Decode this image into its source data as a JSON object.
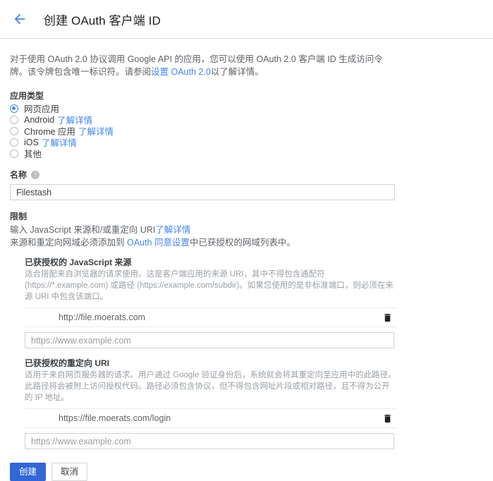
{
  "header": {
    "back_icon": "arrow-left-icon",
    "title": "创建 OAuth 客户端 ID"
  },
  "intro": {
    "text_before": "对于使用 OAuth 2.0 协议调用 Google API 的应用，您可以使用 OAuth 2.0 客户端 ID 生成访问令牌。该令牌包含唯一标识符。请参阅",
    "link": "设置 OAuth 2.0",
    "text_after": "以了解详情。"
  },
  "application_type": {
    "label": "应用类型",
    "selected": "网页应用",
    "options": [
      {
        "label": "网页应用",
        "link": "",
        "selected": true
      },
      {
        "label": "Android",
        "link": "了解详情",
        "selected": false
      },
      {
        "label": "Chrome 应用",
        "link": "了解详情",
        "selected": false
      },
      {
        "label": "iOS",
        "link": "了解详情",
        "selected": false
      },
      {
        "label": "其他",
        "link": "",
        "selected": false
      }
    ]
  },
  "name_field": {
    "label": "名称",
    "help_icon": "help-circle-icon",
    "value": "Filestash",
    "placeholder": ""
  },
  "restrictions": {
    "label": "限制",
    "line1_text": "输入 JavaScript 来源和/或重定向 URI",
    "line1_link": "了解详情",
    "line2_before": "来源和重定向网域必须添加到",
    "line2_link": "OAuth 同意设置",
    "line2_after": "中已获授权的网域列表中。"
  },
  "js_origins": {
    "title": "已获授权的 JavaScript 来源",
    "description": "适合搭配来自浏览器的请求使用。这是客户端应用的来源 URI，其中不得包含通配符 (https://*.example.com) 或路径 (https://example.com/subdir)。如果您使用的是非标准端口，则必须在来源 URI 中包含该端口。",
    "entries": [
      {
        "value": "http://file.moerats.com",
        "delete_icon": "trash-icon"
      }
    ],
    "new_entry_placeholder": "https://www.example.com",
    "new_entry_value": ""
  },
  "redirect_uris": {
    "title": "已获授权的重定向 URI",
    "description": "适用于来自网页服务器的请求。用户通过 Google 验证身份后，系统就会将其重定向至应用中的此路径。此路径将会被附上访问授权代码。路径必须包含协议，但不得包含网址片段或相对路径，且不得为公开的 IP 地址。",
    "entries": [
      {
        "value": "https://file.moerats.com/login",
        "delete_icon": "trash-icon"
      }
    ],
    "new_entry_placeholder": "https://www.example.com",
    "new_entry_value": ""
  },
  "footer": {
    "create_label": "创建",
    "cancel_label": "取消"
  },
  "colors": {
    "accent_blue": "#4285f4",
    "primary_button": "#3367d6",
    "body_text": "#3c4043",
    "muted_text": "#9aa0a6",
    "border": "#d2d2d2"
  }
}
